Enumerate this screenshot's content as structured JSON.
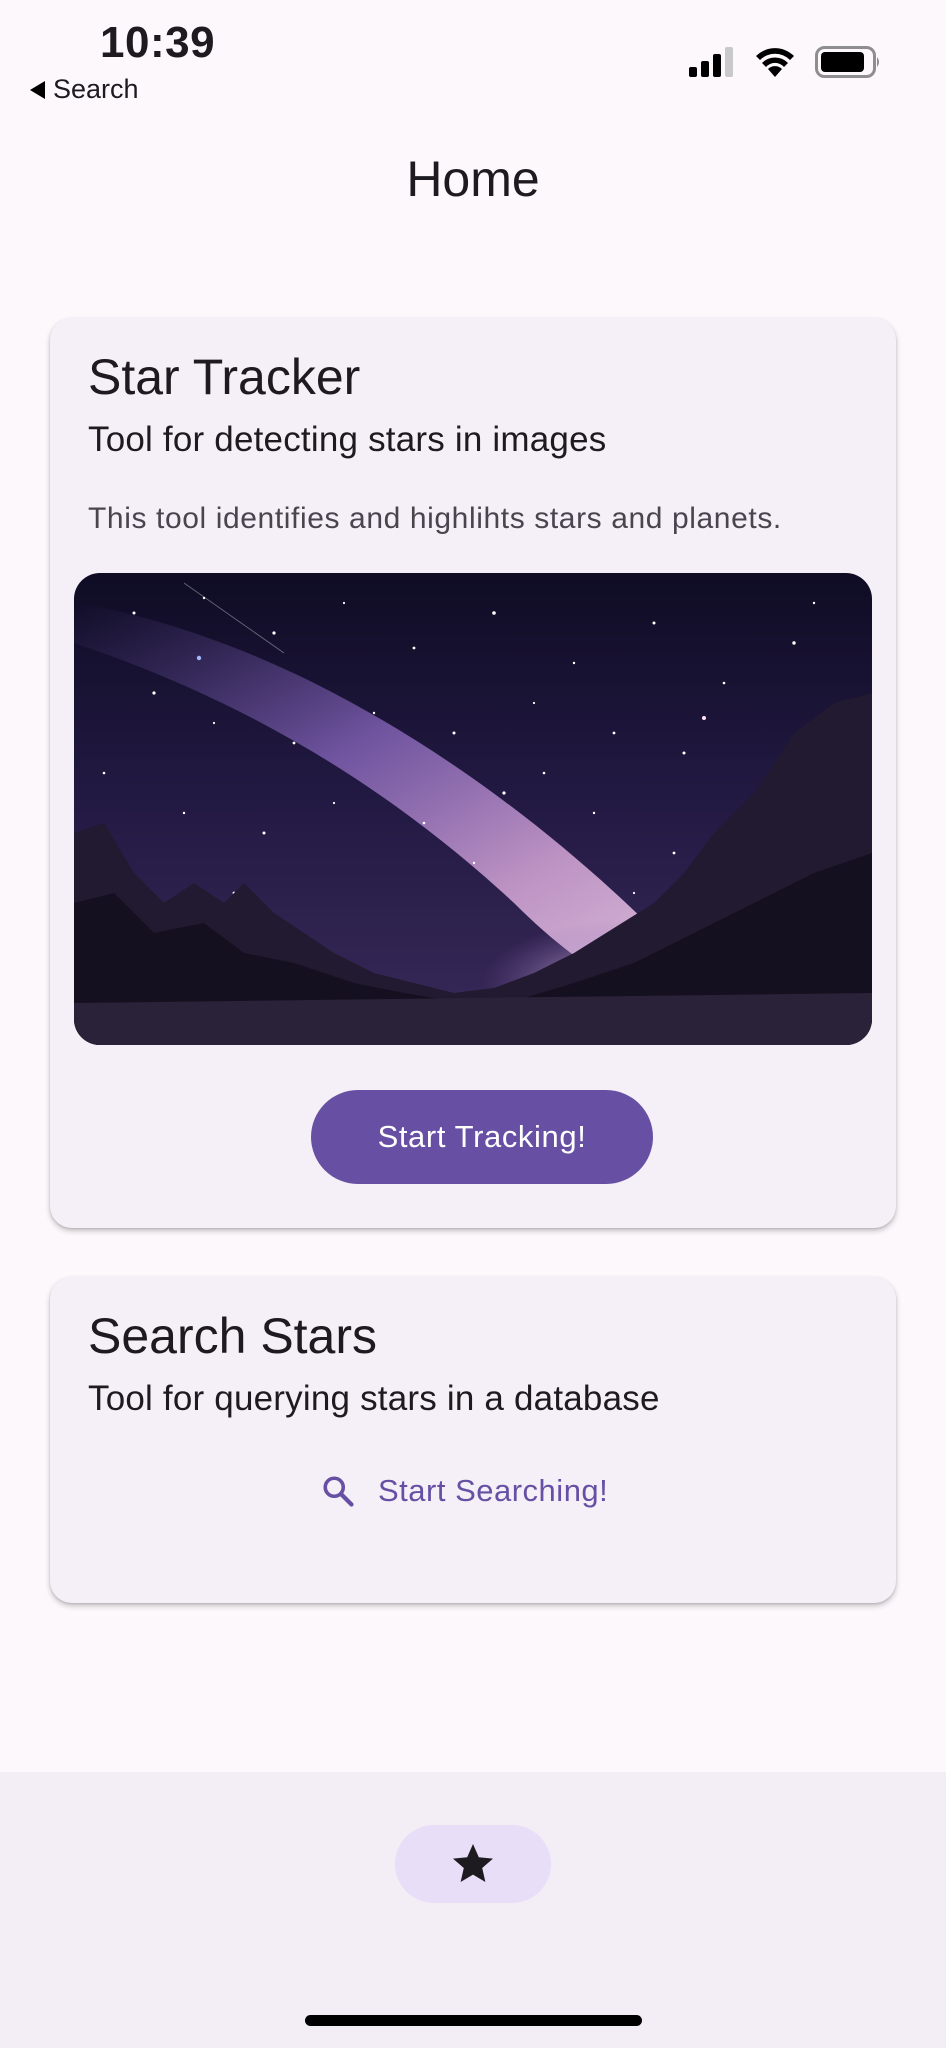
{
  "status_bar": {
    "time": "10:39",
    "back_label": "Search",
    "icons": [
      "signal-icon",
      "wifi-icon",
      "battery-icon"
    ]
  },
  "app_bar": {
    "title": "Home"
  },
  "cards": [
    {
      "title": "Star Tracker",
      "subtitle": "Tool for detecting stars in images",
      "body": "This tool identifies and highlihts stars and planets.",
      "image": "milky-way-night-sky-image",
      "button_label": "Start Tracking!"
    },
    {
      "title": "Search Stars",
      "subtitle": "Tool for querying stars in a database",
      "button_label": "Start Searching!",
      "button_icon": "search-icon"
    }
  ],
  "bottom_nav": {
    "items": [
      {
        "icon": "star-icon",
        "selected": true
      }
    ]
  },
  "colors": {
    "primary": "#6750a4",
    "background": "#fdf8fc",
    "card": "#f5f0f7",
    "nav_background": "#f3edf6",
    "nav_indicator": "#e8def8"
  }
}
